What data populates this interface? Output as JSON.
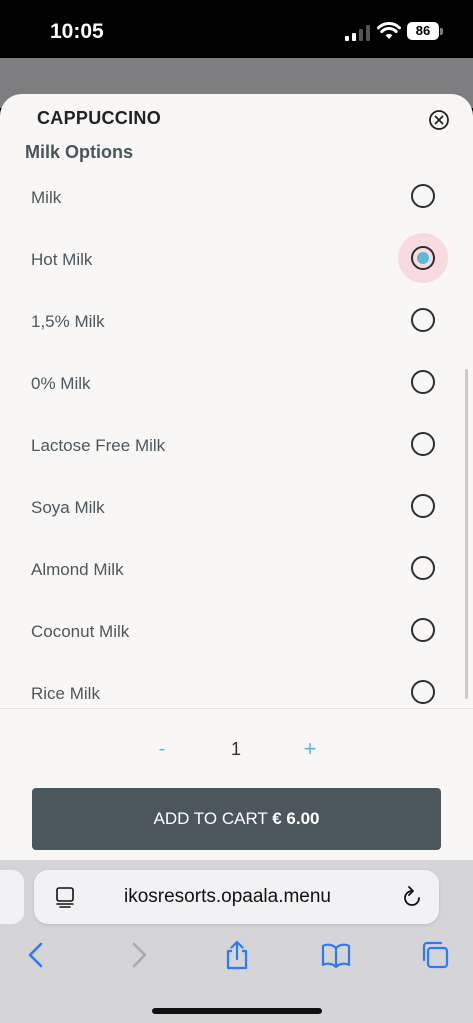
{
  "status_bar": {
    "time": "10:05",
    "battery": "86"
  },
  "dialog": {
    "title": "CAPPUCCINO",
    "section_title": "Milk Options",
    "options": [
      {
        "label": "Milk",
        "selected": false
      },
      {
        "label": "Hot Milk",
        "selected": true
      },
      {
        "label": "1,5% Milk",
        "selected": false
      },
      {
        "label": "0% Milk",
        "selected": false
      },
      {
        "label": "Lactose Free Milk",
        "selected": false
      },
      {
        "label": "Soya Milk",
        "selected": false
      },
      {
        "label": "Almond Milk",
        "selected": false
      },
      {
        "label": "Coconut Milk",
        "selected": false
      },
      {
        "label": "Rice Milk",
        "selected": false
      }
    ]
  },
  "footer": {
    "qty_minus": "-",
    "quantity": "1",
    "qty_plus": "+",
    "add_to_cart_label": "ADD TO CART",
    "price": "€ 6.00"
  },
  "browser": {
    "url": "ikosresorts.opaala.menu",
    "icons": [
      "tabs-overview-icon",
      "reload-icon",
      "back-icon",
      "forward-icon",
      "share-icon",
      "bookmarks-icon",
      "tabs-icon"
    ]
  },
  "colors": {
    "accent": "#5fb8d6",
    "button": "#4b575d",
    "selected_highlight": "#f7dbe0",
    "sheet_bg": "#f8f7f5"
  }
}
